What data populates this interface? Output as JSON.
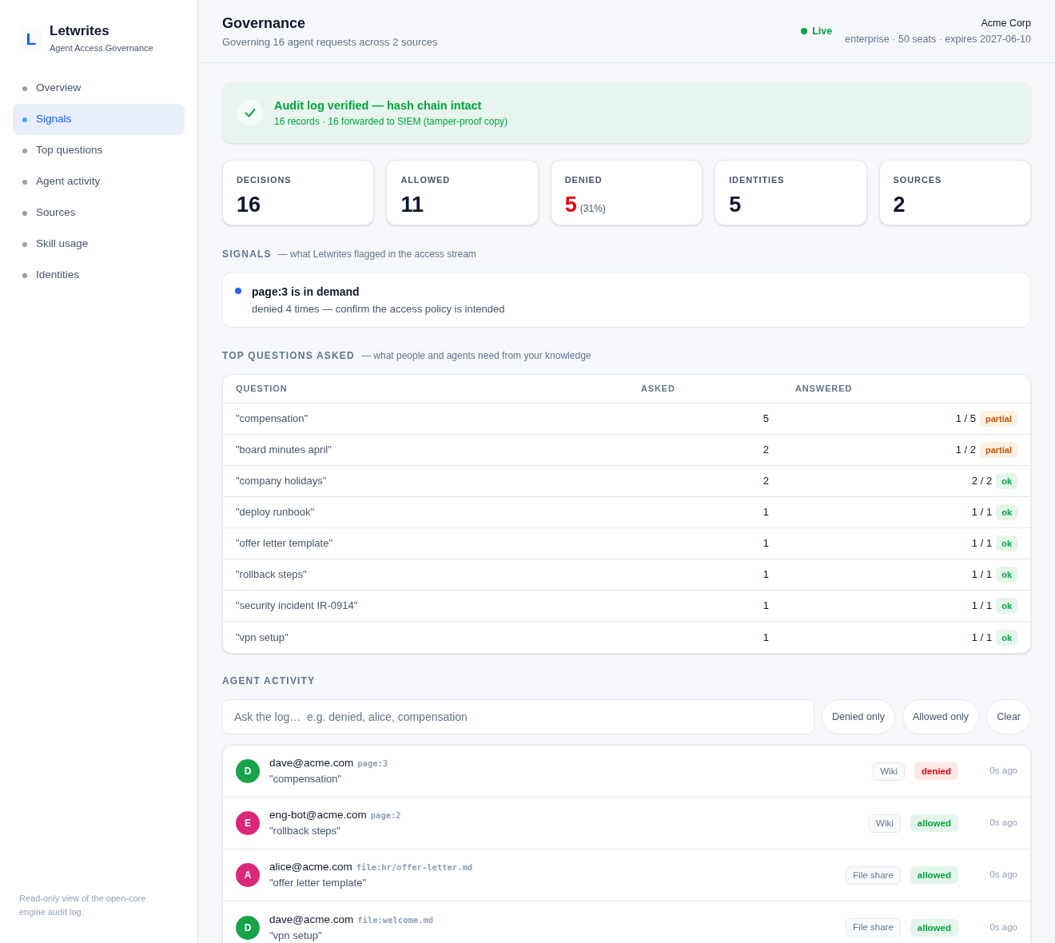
{
  "sidebar": {
    "brand": {
      "mark": "L",
      "name": "Letwrites",
      "tagline": "Agent Access Governance"
    },
    "nav": [
      {
        "label": "Overview",
        "selected": false
      },
      {
        "label": "Signals",
        "selected": true
      },
      {
        "label": "Top questions",
        "selected": false
      },
      {
        "label": "Agent activity",
        "selected": false
      },
      {
        "label": "Sources",
        "selected": false
      },
      {
        "label": "Skill usage",
        "selected": false
      },
      {
        "label": "Identities",
        "selected": false
      }
    ],
    "footer": "Read-only view of the open-core engine audit log."
  },
  "header": {
    "title": "Governance",
    "subtitle": "Governing 16 agent requests across 2 sources",
    "live": "Live",
    "org": "Acme Corp",
    "plan": "enterprise · 50 seats · expires 2027-06-10"
  },
  "banner": {
    "title": "Audit log verified — hash chain intact",
    "detail": "16 records · 16 forwarded to SIEM (tamper-proof copy)"
  },
  "stats": [
    {
      "label": "DECISIONS",
      "value": "16",
      "kind": "plain"
    },
    {
      "label": "ALLOWED",
      "value": "11",
      "kind": "plain"
    },
    {
      "label": "DENIED",
      "value": "5",
      "note": "(31%)",
      "kind": "alert"
    },
    {
      "label": "IDENTITIES",
      "value": "5",
      "kind": "plain"
    },
    {
      "label": "SOURCES",
      "value": "2",
      "kind": "plain"
    }
  ],
  "signals": {
    "heading": "SIGNALS",
    "note": "— what Letwrites flagged in the access stream",
    "items": [
      {
        "title": "page:3 is in demand",
        "detail": "denied 4 times — confirm the access policy is intended",
        "color": "#2563eb"
      }
    ]
  },
  "top_questions": {
    "heading": "TOP QUESTIONS ASKED",
    "note": "— what people and agents need from your knowledge",
    "columns": [
      "QUESTION",
      "ASKED",
      "ANSWERED"
    ],
    "rows": [
      {
        "question": "\"compensation\"",
        "asked": "5",
        "answered": "1 / 5",
        "badge": {
          "label": "partial",
          "kind": "partial"
        }
      },
      {
        "question": "\"board minutes april\"",
        "asked": "2",
        "answered": "1 / 2",
        "badge": {
          "label": "partial",
          "kind": "partial"
        }
      },
      {
        "question": "\"company holidays\"",
        "asked": "2",
        "answered": "2 / 2",
        "badge": {
          "label": "ok",
          "kind": "ok"
        }
      },
      {
        "question": "\"deploy runbook\"",
        "asked": "1",
        "answered": "1 / 1",
        "badge": {
          "label": "ok",
          "kind": "ok"
        }
      },
      {
        "question": "\"offer letter template\"",
        "asked": "1",
        "answered": "1 / 1",
        "badge": {
          "label": "ok",
          "kind": "ok"
        }
      },
      {
        "question": "\"rollback steps\"",
        "asked": "1",
        "answered": "1 / 1",
        "badge": {
          "label": "ok",
          "kind": "ok"
        }
      },
      {
        "question": "\"security incident IR-0914\"",
        "asked": "1",
        "answered": "1 / 1",
        "badge": {
          "label": "ok",
          "kind": "ok"
        }
      },
      {
        "question": "\"vpn setup\"",
        "asked": "1",
        "answered": "1 / 1",
        "badge": {
          "label": "ok",
          "kind": "ok"
        }
      }
    ]
  },
  "agent_activity": {
    "heading": "AGENT ACTIVITY",
    "search": {
      "placeholder": "Ask the log…  e.g. denied, alice, compensation"
    },
    "filters": [
      "Denied only",
      "Allowed only",
      "Clear"
    ],
    "entries": [
      {
        "initial": "D",
        "color": "#16a34a",
        "identity": "dave@acme.com",
        "resource": "page:3",
        "query": "\"compensation\"",
        "source": "Wiki",
        "decision": {
          "label": "denied",
          "kind": "denied"
        },
        "time": "0s ago"
      },
      {
        "initial": "E",
        "color": "#db2777",
        "identity": "eng-bot@acme.com",
        "resource": "page:2",
        "query": "\"rollback steps\"",
        "source": "Wiki",
        "decision": {
          "label": "allowed",
          "kind": "allowed"
        },
        "time": "0s ago"
      },
      {
        "initial": "A",
        "color": "#db2777",
        "identity": "alice@acme.com",
        "resource": "file:hr/offer-letter.md",
        "query": "\"offer letter template\"",
        "source": "File share",
        "decision": {
          "label": "allowed",
          "kind": "allowed"
        },
        "time": "0s ago"
      },
      {
        "initial": "D",
        "color": "#16a34a",
        "identity": "dave@acme.com",
        "resource": "file:welcome.md",
        "query": "\"vpn setup\"",
        "source": "File share",
        "decision": {
          "label": "allowed",
          "kind": "allowed"
        },
        "time": "0s ago"
      }
    ]
  }
}
